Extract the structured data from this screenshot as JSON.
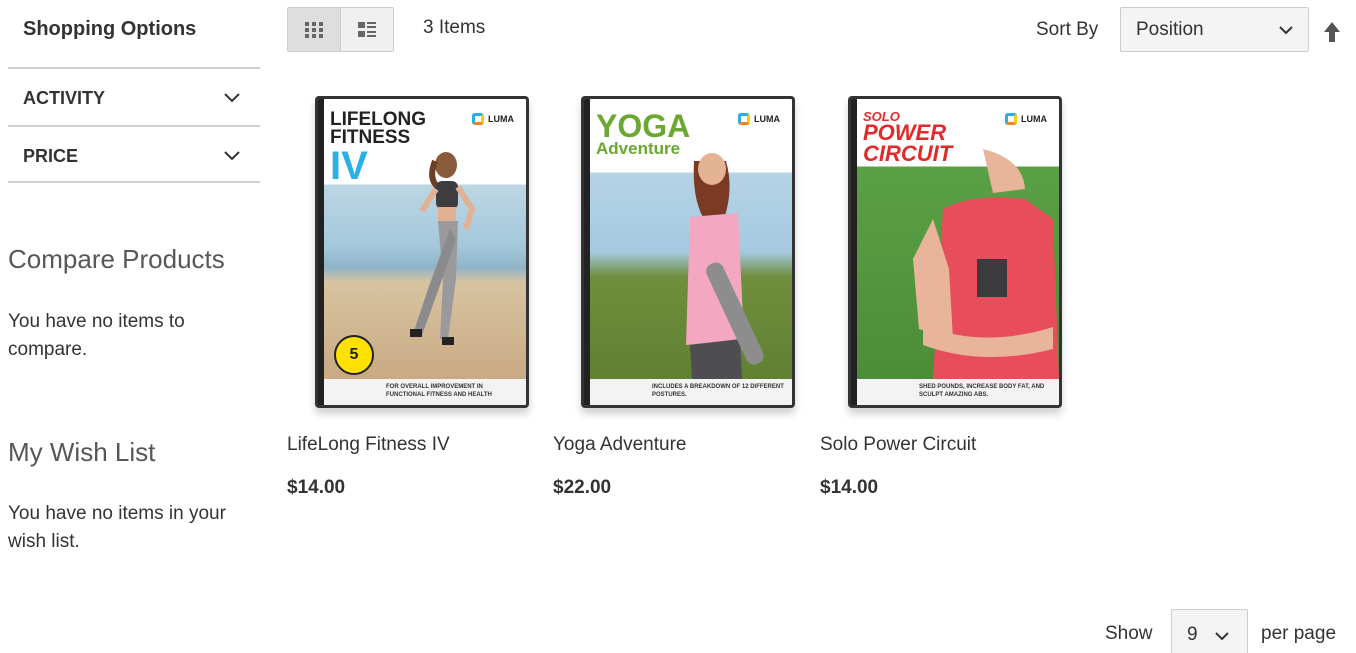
{
  "sidebar": {
    "title": "Shopping Options",
    "filters": [
      {
        "label": "ACTIVITY",
        "icon": "chevron-down-icon"
      },
      {
        "label": "PRICE",
        "icon": "chevron-down-icon"
      }
    ],
    "compare": {
      "title": "Compare Products",
      "text": "You have no items to compare."
    },
    "wishlist": {
      "title": "My Wish List",
      "text": "You have no items in your wish list."
    }
  },
  "toolbar": {
    "view_modes": [
      {
        "name": "grid",
        "icon": "grid-view-icon",
        "active": true
      },
      {
        "name": "list",
        "icon": "list-view-icon",
        "active": false
      }
    ],
    "items_count": "3 Items",
    "sort_label": "Sort By",
    "sort_value": "Position",
    "sort_direction_icon": "arrow-up-icon",
    "show_label": "Show",
    "limit_value": "9",
    "per_page_label": "per page"
  },
  "products": [
    {
      "name": "LifeLong Fitness IV",
      "price": "$14.00",
      "cover": {
        "title_lines": [
          "LIFELONG",
          "FITNESS",
          "IV"
        ],
        "title_color": "#222222",
        "accent_color": "#2bb0e6",
        "brand": "LUMA",
        "footer": "FOR OVERALL IMPROVEMENT IN FUNCTIONAL FITNESS AND HEALTH"
      }
    },
    {
      "name": "Yoga Adventure",
      "price": "$22.00",
      "cover": {
        "title_lines": [
          "YOGA",
          "Adventure"
        ],
        "title_color": "#6aa832",
        "accent_color": "#6aa832",
        "brand": "LUMA",
        "footer": "INCLUDES A BREAKDOWN OF 12 DIFFERENT POSTURES."
      }
    },
    {
      "name": "Solo Power Circuit",
      "price": "$14.00",
      "cover": {
        "title_lines": [
          "SOLO",
          "POWER",
          "CIRCUIT"
        ],
        "title_color": "#e02b2b",
        "accent_color": "#e02b2b",
        "brand": "LUMA",
        "footer": "SHED POUNDS, INCREASE BODY FAT, AND SCULPT AMAZING ABS."
      }
    }
  ],
  "colors": {
    "text": "#333333",
    "muted_title": "#575757",
    "border": "#d1d1d1",
    "select_bg": "#f4f4f4"
  }
}
